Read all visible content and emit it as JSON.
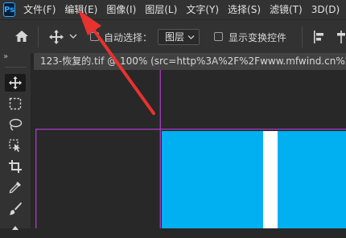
{
  "app": {
    "logo_text": "Ps"
  },
  "menu": [
    {
      "label": "文件(F)"
    },
    {
      "label": "编辑(E)"
    },
    {
      "label": "图像(I)"
    },
    {
      "label": "图层(L)"
    },
    {
      "label": "文字(Y)"
    },
    {
      "label": "选择(S)"
    },
    {
      "label": "滤镜(T)"
    },
    {
      "label": "3D(D)"
    }
  ],
  "options": {
    "auto_select_label": "自动选择：",
    "auto_select_value": "图层",
    "show_transform_label": "显示变换控件",
    "panel_toggle": "»"
  },
  "document": {
    "tab_title": "123-恢复的.tif @ 100% (src=http%3A%2F%2Fwww.mfwind.cn%2Fupload"
  },
  "colors": {
    "accent_red": "#e8322f",
    "image_blue": "#00b0f0",
    "guide_magenta": "#a03ab8"
  }
}
